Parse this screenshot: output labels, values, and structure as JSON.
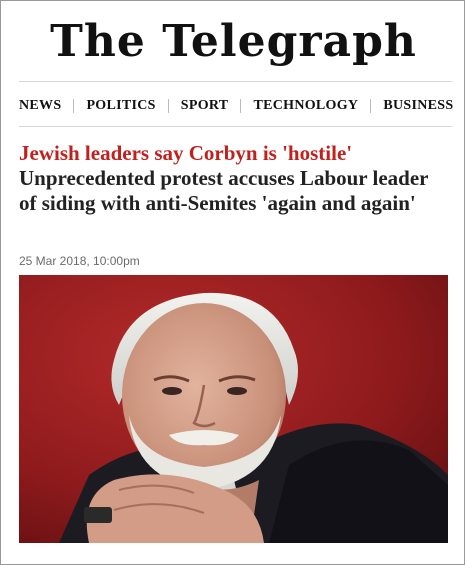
{
  "masthead": {
    "logo_text": "The Telegraph"
  },
  "nav": {
    "items": [
      "NEWS",
      "POLITICS",
      "SPORT",
      "TECHNOLOGY",
      "BUSINESS"
    ]
  },
  "article": {
    "kicker": "Jewish leaders say Corbyn is 'hostile'",
    "headline": "Unprecedented protest accuses Labour leader of siding with anti-Semites 'again and again'",
    "date": "25 Mar 2018, 10:00pm"
  },
  "colors": {
    "kicker": "#c0211d",
    "photo_background": "#8a1618"
  }
}
